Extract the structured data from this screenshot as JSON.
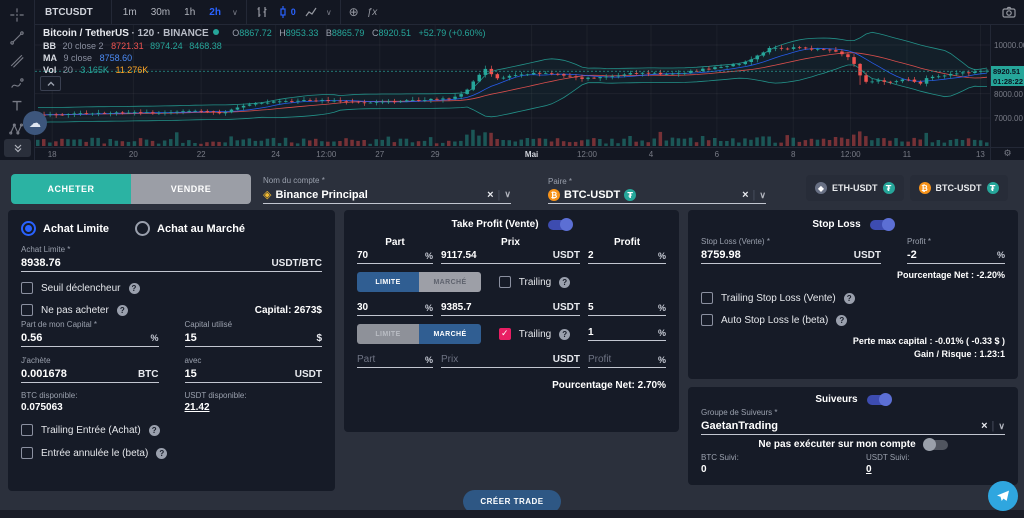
{
  "icons": {
    "compare": "⊕",
    "fx": "ƒx",
    "gear": "⚙",
    "cloud": "☁",
    "dropdown": "∨",
    "clear": "×",
    "help": "?",
    "check": "✓",
    "binance": "◈",
    "btc": "₿",
    "usdt": "₮",
    "eth": "◆",
    "indicator_zero": "0"
  },
  "chart": {
    "toolbar": {
      "symbol": "BTCUSDT",
      "timeframes": [
        "1m",
        "30m",
        "1h",
        "2h"
      ],
      "active_timeframe": "2h"
    },
    "legend": {
      "symbol": "Bitcoin / TetherUS",
      "meta": "· 120 · BINANCE",
      "ohlc": [
        {
          "k": "O",
          "v": "8867.72"
        },
        {
          "k": "H",
          "v": "8953.33"
        },
        {
          "k": "B",
          "v": "8865.79"
        },
        {
          "k": "C",
          "v": "8920.51"
        }
      ],
      "change": "+52.79 (+0.60%)",
      "bb_label": "BB",
      "bb_params": "20 close 2",
      "bb_values": [
        "8721.31",
        "8974.24",
        "8468.38"
      ],
      "ma_label": "MA",
      "ma_params": "9 close",
      "ma_value": "8758.60",
      "vol_label": "Vol",
      "vol_params": "20",
      "vol_values": [
        "3.165K",
        "11.276K"
      ]
    },
    "price_axis": {
      "labels": [
        {
          "text": "10000.00",
          "price": 10000
        },
        {
          "text": "8000.00",
          "price": 8000
        },
        {
          "text": "7000.00",
          "price": 7000
        }
      ],
      "last_price": "8920.51",
      "last_price_value": 8920.51,
      "countdown": "01:28:22"
    },
    "time_axis": [
      {
        "text": "18",
        "pos": 0.018
      },
      {
        "text": "20",
        "pos": 0.103
      },
      {
        "text": "22",
        "pos": 0.174
      },
      {
        "text": "24",
        "pos": 0.252
      },
      {
        "text": "12:00",
        "pos": 0.305
      },
      {
        "text": "27",
        "pos": 0.361
      },
      {
        "text": "29",
        "pos": 0.419
      },
      {
        "text": "Mai",
        "pos": 0.52,
        "bold": true
      },
      {
        "text": "12:00",
        "pos": 0.578
      },
      {
        "text": "4",
        "pos": 0.645
      },
      {
        "text": "6",
        "pos": 0.714
      },
      {
        "text": "8",
        "pos": 0.794
      },
      {
        "text": "12:00",
        "pos": 0.854
      },
      {
        "text": "11",
        "pos": 0.913
      },
      {
        "text": "13",
        "pos": 0.99
      }
    ],
    "chart_data": {
      "type": "candlestick",
      "symbol": "BTCUSDT",
      "interval_minutes": 120,
      "visible_range": "Apr 18 - May 13",
      "y_domain": [
        5900,
        10850
      ],
      "grid_prices": [
        10000,
        9000,
        8000,
        7000
      ],
      "indicators": [
        "BB(20, close, 2)",
        "MA(9, close)",
        "Volume(20)"
      ],
      "last_price": 8920.51,
      "price_path": [
        [
          0.0,
          7120
        ],
        [
          0.04,
          7170
        ],
        [
          0.08,
          7210
        ],
        [
          0.12,
          7230
        ],
        [
          0.15,
          7260
        ],
        [
          0.175,
          7280
        ],
        [
          0.195,
          7190
        ],
        [
          0.21,
          7450
        ],
        [
          0.235,
          7630
        ],
        [
          0.26,
          7690
        ],
        [
          0.29,
          7740
        ],
        [
          0.32,
          7700
        ],
        [
          0.35,
          7630
        ],
        [
          0.38,
          7690
        ],
        [
          0.41,
          7760
        ],
        [
          0.435,
          7800
        ],
        [
          0.45,
          8030
        ],
        [
          0.462,
          8700
        ],
        [
          0.472,
          9020
        ],
        [
          0.482,
          8640
        ],
        [
          0.5,
          8730
        ],
        [
          0.53,
          8860
        ],
        [
          0.55,
          8770
        ],
        [
          0.572,
          8620
        ],
        [
          0.6,
          8680
        ],
        [
          0.625,
          8830
        ],
        [
          0.645,
          8860
        ],
        [
          0.665,
          8790
        ],
        [
          0.685,
          8890
        ],
        [
          0.705,
          9030
        ],
        [
          0.725,
          9130
        ],
        [
          0.745,
          9280
        ],
        [
          0.758,
          9580
        ],
        [
          0.772,
          9880
        ],
        [
          0.785,
          9840
        ],
        [
          0.8,
          9910
        ],
        [
          0.815,
          9790
        ],
        [
          0.828,
          9830
        ],
        [
          0.843,
          9700
        ],
        [
          0.856,
          9480
        ],
        [
          0.866,
          8750
        ],
        [
          0.874,
          8420
        ],
        [
          0.885,
          8560
        ],
        [
          0.895,
          8430
        ],
        [
          0.905,
          8490
        ],
        [
          0.915,
          8630
        ],
        [
          0.922,
          8500
        ],
        [
          0.93,
          8430
        ],
        [
          0.938,
          8670
        ],
        [
          0.95,
          8720
        ],
        [
          0.962,
          8790
        ],
        [
          0.975,
          8860
        ],
        [
          1.0,
          8925
        ]
      ],
      "colors": {
        "up": "#26a69a",
        "down": "#ef5350",
        "bb": "#26a69a",
        "basis": "#ef5350",
        "ma": "#2962ff"
      }
    }
  },
  "order_bar": {
    "buy": "ACHETER",
    "sell": "VENDRE",
    "account": {
      "label": "Nom du compte *",
      "value": "Binance Principal"
    },
    "pair": {
      "label": "Paire *",
      "value": "BTC-USDT"
    },
    "chips": [
      {
        "label": "ETH-USDT"
      },
      {
        "label": "BTC-USDT"
      }
    ]
  },
  "entry_panel": {
    "mode_limit": "Achat Limite",
    "mode_market": "Achat au Marché",
    "limit": {
      "label": "Achat Limite *",
      "value": "8938.76",
      "unit": "USDT/BTC"
    },
    "trigger": "Seuil déclencheur",
    "no_buy": "Ne pas acheter",
    "capital": "Capital: 2673$",
    "part": {
      "label": "Part de mon Capital *",
      "value": "0.56",
      "unit": "%"
    },
    "used": {
      "label": "Capital utilisé",
      "value": "15",
      "unit": "$"
    },
    "buy": {
      "label": "J'achète",
      "value": "0.001678",
      "unit": "BTC"
    },
    "with": {
      "label": "avec",
      "value": "15",
      "unit": "USDT"
    },
    "btc_avail": {
      "label": "BTC disponible:",
      "value": "0.075063"
    },
    "usdt_avail": {
      "label": "USDT disponible:",
      "value": "21.42"
    },
    "trailing": "Trailing Entrée (Achat)",
    "cancel": "Entrée annulée le (beta)"
  },
  "tp_panel": {
    "title": "Take Profit (Vente)",
    "col_part": "Part",
    "col_price": "Prix",
    "col_profit": "Profit",
    "pct": "%",
    "usdt": "USDT",
    "limit_label": "LIMITE",
    "market_label": "MARCHÉ",
    "trailing_label": "Trailing",
    "rows": [
      {
        "part": "70",
        "price": "9117.54",
        "profit": "2"
      },
      {
        "part": "30",
        "price": "9385.7",
        "profit": "5",
        "trailing_value": "1"
      }
    ],
    "placeholders": {
      "part": "Part",
      "price": "Prix",
      "profit": "Profit"
    },
    "net": "Pourcentage Net: 2.70%"
  },
  "sl_panel": {
    "title": "Stop Loss",
    "stop": {
      "label": "Stop Loss (Vente) *",
      "value": "8759.98",
      "unit": "USDT"
    },
    "profit": {
      "label": "Profit *",
      "value": "-2",
      "unit": "%"
    },
    "net": "Pourcentage Net : -2.20%",
    "trailing": "Trailing Stop Loss (Vente)",
    "auto": "Auto Stop Loss le (beta)",
    "max_loss": "Perte max capital : -0.01% ( -0.33 $ )",
    "risk": "Gain / Risque : 1.23:1"
  },
  "followers_panel": {
    "title": "Suiveurs",
    "group": {
      "label": "Groupe de Suiveurs *",
      "value": "GaetanTrading"
    },
    "no_exec": "Ne pas exécuter sur mon compte",
    "btc": {
      "label": "BTC Suivi:",
      "value": "0"
    },
    "usdt": {
      "label": "USDT Suivi:",
      "value": "0"
    }
  },
  "footer": {
    "create_label": "CRÉER TRADE"
  }
}
